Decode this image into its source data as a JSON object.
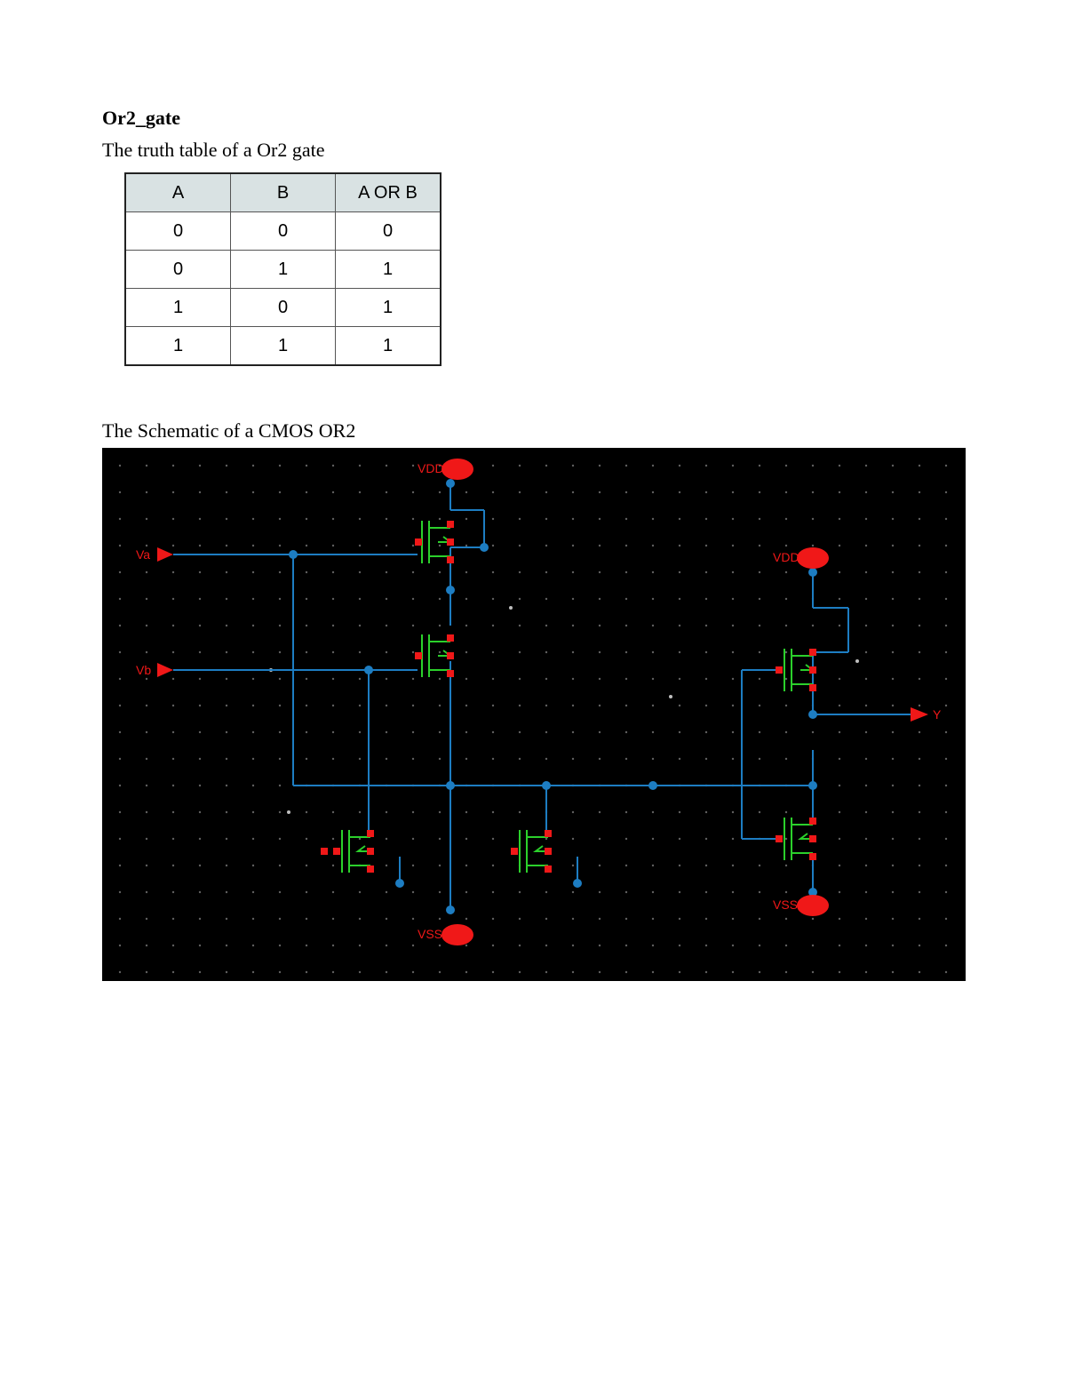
{
  "heading": "Or2_gate",
  "truth_caption": "The truth table of a Or2 gate",
  "truth_table": {
    "headers": [
      "A",
      "B",
      "A OR B"
    ],
    "rows": [
      [
        "0",
        "0",
        "0"
      ],
      [
        "0",
        "1",
        "1"
      ],
      [
        "1",
        "0",
        "1"
      ],
      [
        "1",
        "1",
        "1"
      ]
    ]
  },
  "schematic_caption": "The Schematic of a CMOS OR2",
  "schematic_labels": {
    "vdd1": "VDD",
    "vdd2": "VDD",
    "vss1": "VSS",
    "vss2": "VSS",
    "va": "Va",
    "vb": "Vb",
    "y": "Y"
  }
}
